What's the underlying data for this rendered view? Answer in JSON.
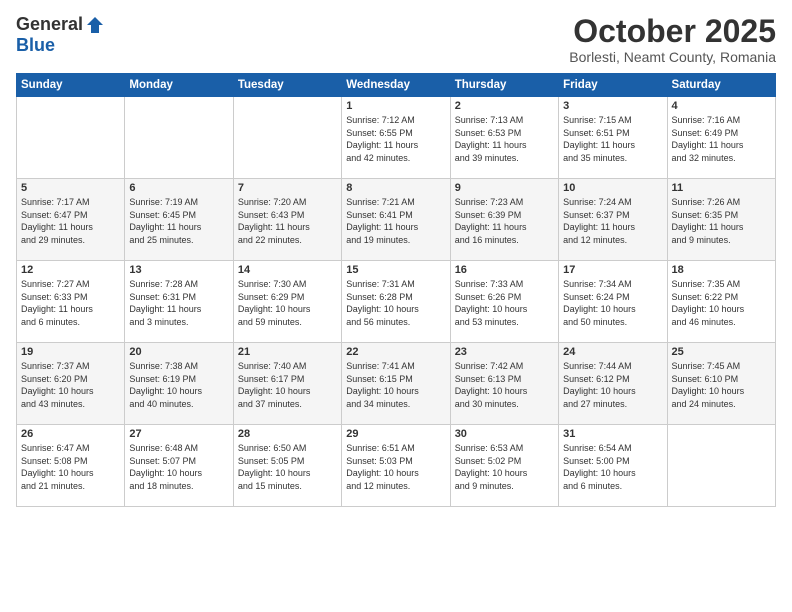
{
  "header": {
    "logo_general": "General",
    "logo_blue": "Blue",
    "month": "October 2025",
    "location": "Borlesti, Neamt County, Romania"
  },
  "weekdays": [
    "Sunday",
    "Monday",
    "Tuesday",
    "Wednesday",
    "Thursday",
    "Friday",
    "Saturday"
  ],
  "weeks": [
    [
      {
        "day": "",
        "info": ""
      },
      {
        "day": "",
        "info": ""
      },
      {
        "day": "",
        "info": ""
      },
      {
        "day": "1",
        "info": "Sunrise: 7:12 AM\nSunset: 6:55 PM\nDaylight: 11 hours\nand 42 minutes."
      },
      {
        "day": "2",
        "info": "Sunrise: 7:13 AM\nSunset: 6:53 PM\nDaylight: 11 hours\nand 39 minutes."
      },
      {
        "day": "3",
        "info": "Sunrise: 7:15 AM\nSunset: 6:51 PM\nDaylight: 11 hours\nand 35 minutes."
      },
      {
        "day": "4",
        "info": "Sunrise: 7:16 AM\nSunset: 6:49 PM\nDaylight: 11 hours\nand 32 minutes."
      }
    ],
    [
      {
        "day": "5",
        "info": "Sunrise: 7:17 AM\nSunset: 6:47 PM\nDaylight: 11 hours\nand 29 minutes."
      },
      {
        "day": "6",
        "info": "Sunrise: 7:19 AM\nSunset: 6:45 PM\nDaylight: 11 hours\nand 25 minutes."
      },
      {
        "day": "7",
        "info": "Sunrise: 7:20 AM\nSunset: 6:43 PM\nDaylight: 11 hours\nand 22 minutes."
      },
      {
        "day": "8",
        "info": "Sunrise: 7:21 AM\nSunset: 6:41 PM\nDaylight: 11 hours\nand 19 minutes."
      },
      {
        "day": "9",
        "info": "Sunrise: 7:23 AM\nSunset: 6:39 PM\nDaylight: 11 hours\nand 16 minutes."
      },
      {
        "day": "10",
        "info": "Sunrise: 7:24 AM\nSunset: 6:37 PM\nDaylight: 11 hours\nand 12 minutes."
      },
      {
        "day": "11",
        "info": "Sunrise: 7:26 AM\nSunset: 6:35 PM\nDaylight: 11 hours\nand 9 minutes."
      }
    ],
    [
      {
        "day": "12",
        "info": "Sunrise: 7:27 AM\nSunset: 6:33 PM\nDaylight: 11 hours\nand 6 minutes."
      },
      {
        "day": "13",
        "info": "Sunrise: 7:28 AM\nSunset: 6:31 PM\nDaylight: 11 hours\nand 3 minutes."
      },
      {
        "day": "14",
        "info": "Sunrise: 7:30 AM\nSunset: 6:29 PM\nDaylight: 10 hours\nand 59 minutes."
      },
      {
        "day": "15",
        "info": "Sunrise: 7:31 AM\nSunset: 6:28 PM\nDaylight: 10 hours\nand 56 minutes."
      },
      {
        "day": "16",
        "info": "Sunrise: 7:33 AM\nSunset: 6:26 PM\nDaylight: 10 hours\nand 53 minutes."
      },
      {
        "day": "17",
        "info": "Sunrise: 7:34 AM\nSunset: 6:24 PM\nDaylight: 10 hours\nand 50 minutes."
      },
      {
        "day": "18",
        "info": "Sunrise: 7:35 AM\nSunset: 6:22 PM\nDaylight: 10 hours\nand 46 minutes."
      }
    ],
    [
      {
        "day": "19",
        "info": "Sunrise: 7:37 AM\nSunset: 6:20 PM\nDaylight: 10 hours\nand 43 minutes."
      },
      {
        "day": "20",
        "info": "Sunrise: 7:38 AM\nSunset: 6:19 PM\nDaylight: 10 hours\nand 40 minutes."
      },
      {
        "day": "21",
        "info": "Sunrise: 7:40 AM\nSunset: 6:17 PM\nDaylight: 10 hours\nand 37 minutes."
      },
      {
        "day": "22",
        "info": "Sunrise: 7:41 AM\nSunset: 6:15 PM\nDaylight: 10 hours\nand 34 minutes."
      },
      {
        "day": "23",
        "info": "Sunrise: 7:42 AM\nSunset: 6:13 PM\nDaylight: 10 hours\nand 30 minutes."
      },
      {
        "day": "24",
        "info": "Sunrise: 7:44 AM\nSunset: 6:12 PM\nDaylight: 10 hours\nand 27 minutes."
      },
      {
        "day": "25",
        "info": "Sunrise: 7:45 AM\nSunset: 6:10 PM\nDaylight: 10 hours\nand 24 minutes."
      }
    ],
    [
      {
        "day": "26",
        "info": "Sunrise: 6:47 AM\nSunset: 5:08 PM\nDaylight: 10 hours\nand 21 minutes."
      },
      {
        "day": "27",
        "info": "Sunrise: 6:48 AM\nSunset: 5:07 PM\nDaylight: 10 hours\nand 18 minutes."
      },
      {
        "day": "28",
        "info": "Sunrise: 6:50 AM\nSunset: 5:05 PM\nDaylight: 10 hours\nand 15 minutes."
      },
      {
        "day": "29",
        "info": "Sunrise: 6:51 AM\nSunset: 5:03 PM\nDaylight: 10 hours\nand 12 minutes."
      },
      {
        "day": "30",
        "info": "Sunrise: 6:53 AM\nSunset: 5:02 PM\nDaylight: 10 hours\nand 9 minutes."
      },
      {
        "day": "31",
        "info": "Sunrise: 6:54 AM\nSunset: 5:00 PM\nDaylight: 10 hours\nand 6 minutes."
      },
      {
        "day": "",
        "info": ""
      }
    ]
  ]
}
